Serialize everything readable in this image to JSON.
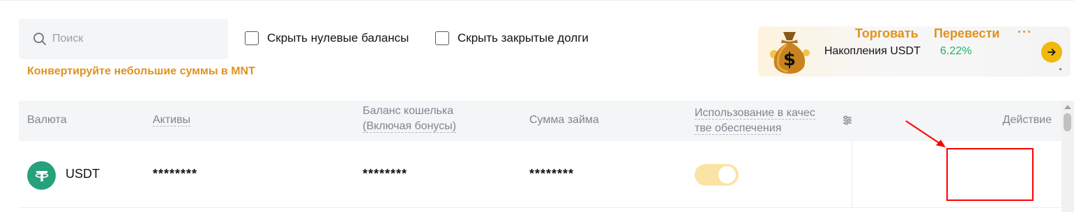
{
  "search": {
    "placeholder": "Поиск"
  },
  "filters": {
    "hide_zero": "Скрыть нулевые балансы",
    "hide_closed_debts": "Скрыть закрытые долги"
  },
  "convert_link": "Конвертируйте небольшие суммы в MNT",
  "promo": {
    "title": "Накопления USDT",
    "rate": "6.22%"
  },
  "table": {
    "headers": {
      "currency": "Валюта",
      "assets": "Активы",
      "balance_line1": "Баланс кошелька",
      "balance_line2": "(Включая бонусы)",
      "loan": "Сумма займа",
      "collateral_line1": "Использование в качес",
      "collateral_line2": "тве обеспечения",
      "action": "Действие"
    },
    "rows": [
      {
        "currency": "USDT",
        "assets": "********",
        "balance": "********",
        "loan": "********",
        "collateral_enabled": true,
        "actions": {
          "trade": "Торговать",
          "transfer": "Перевести",
          "more": "···"
        }
      }
    ]
  },
  "icons": {
    "search": "search-icon",
    "arrow": "arrow-right-icon",
    "filter": "column-settings-icon",
    "coin": "tether-icon",
    "promo": "money-bag-icon"
  },
  "colors": {
    "accent": "#e0921e",
    "rate_green": "#20b26c",
    "usdt": "#26a17b",
    "annotation": "#ff0000"
  }
}
